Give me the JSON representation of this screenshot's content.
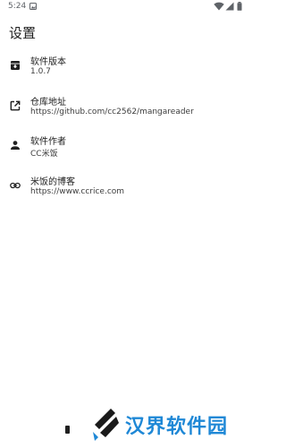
{
  "status_bar": {
    "time": "5:24"
  },
  "page": {
    "title": "设置"
  },
  "items": [
    {
      "label": "软件版本",
      "value": "1.0.7",
      "icon": "archive-icon"
    },
    {
      "label": "仓库地址",
      "value": "https://github.com/cc2562/mangareader",
      "icon": "open-in-new-icon"
    },
    {
      "label": "软件作者",
      "value": "CC米饭",
      "icon": "person-icon"
    },
    {
      "label": "米饭的博客",
      "value": "https://www.ccrice.com",
      "icon": "link-icon"
    }
  ],
  "watermark": {
    "brand": "汉界软件园"
  }
}
